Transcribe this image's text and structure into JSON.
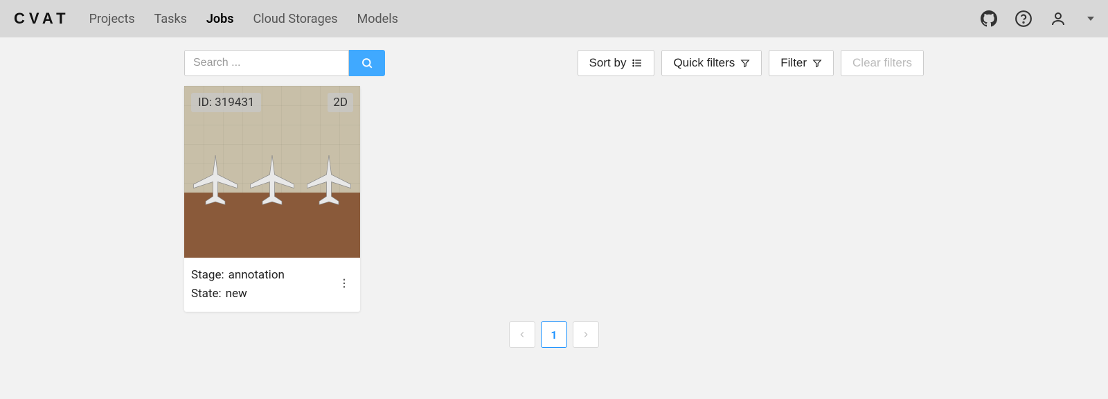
{
  "header": {
    "logo": "CVAT",
    "nav": [
      {
        "label": "Projects",
        "active": false
      },
      {
        "label": "Tasks",
        "active": false
      },
      {
        "label": "Jobs",
        "active": true
      },
      {
        "label": "Cloud Storages",
        "active": false
      },
      {
        "label": "Models",
        "active": false
      }
    ]
  },
  "search": {
    "placeholder": "Search ...",
    "value": ""
  },
  "toolbar": {
    "sort_by_label": "Sort by",
    "quick_filters_label": "Quick filters",
    "filter_label": "Filter",
    "clear_filters_label": "Clear filters"
  },
  "jobs": [
    {
      "id_label": "ID: 319431",
      "dim_badge": "2D",
      "stage_key": "Stage:",
      "stage_value": "annotation",
      "state_key": "State:",
      "state_value": "new"
    }
  ],
  "pagination": {
    "current": "1"
  }
}
